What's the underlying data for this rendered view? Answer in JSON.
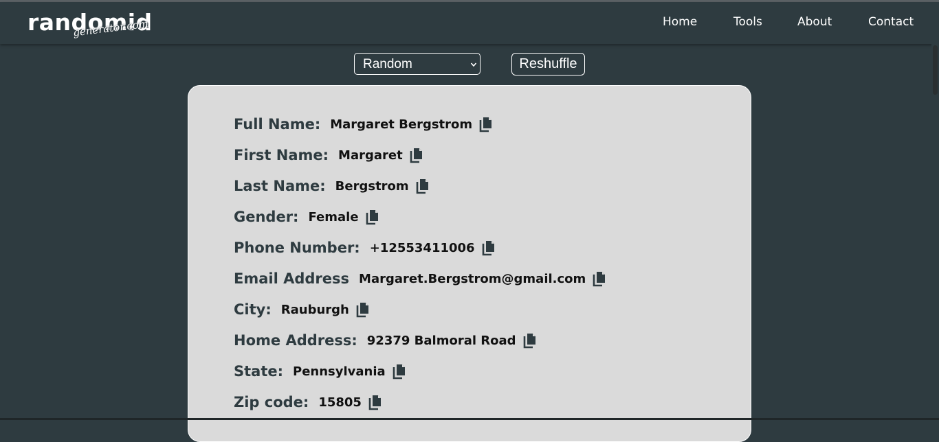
{
  "logo": {
    "main": "randomid",
    "sub": "generator.com"
  },
  "nav": [
    {
      "label": "Home"
    },
    {
      "label": "Tools"
    },
    {
      "label": "About"
    },
    {
      "label": "Contact"
    }
  ],
  "controls": {
    "select_value": "Random",
    "reshuffle_label": "Reshuffle"
  },
  "fields": [
    {
      "label": "Full Name:",
      "value": "Margaret Bergstrom"
    },
    {
      "label": "First Name:",
      "value": "Margaret"
    },
    {
      "label": "Last Name:",
      "value": "Bergstrom"
    },
    {
      "label": "Gender:",
      "value": "Female"
    },
    {
      "label": "Phone Number:",
      "value": "+12553411006"
    },
    {
      "label": "Email Address",
      "value": "Margaret.Bergstrom@gmail.com"
    },
    {
      "label": "City:",
      "value": "Rauburgh"
    },
    {
      "label": "Home Address:",
      "value": "92379 Balmoral Road"
    },
    {
      "label": "State:",
      "value": "Pennsylvania"
    },
    {
      "label": "Zip code:",
      "value": "15805"
    }
  ],
  "icons": {
    "copy": "copy-icon",
    "dropdown": "chevron-down-icon"
  },
  "colors": {
    "background": "#2e3b40",
    "card": "#dadada",
    "label": "#2e3b40",
    "value": "#111111"
  }
}
